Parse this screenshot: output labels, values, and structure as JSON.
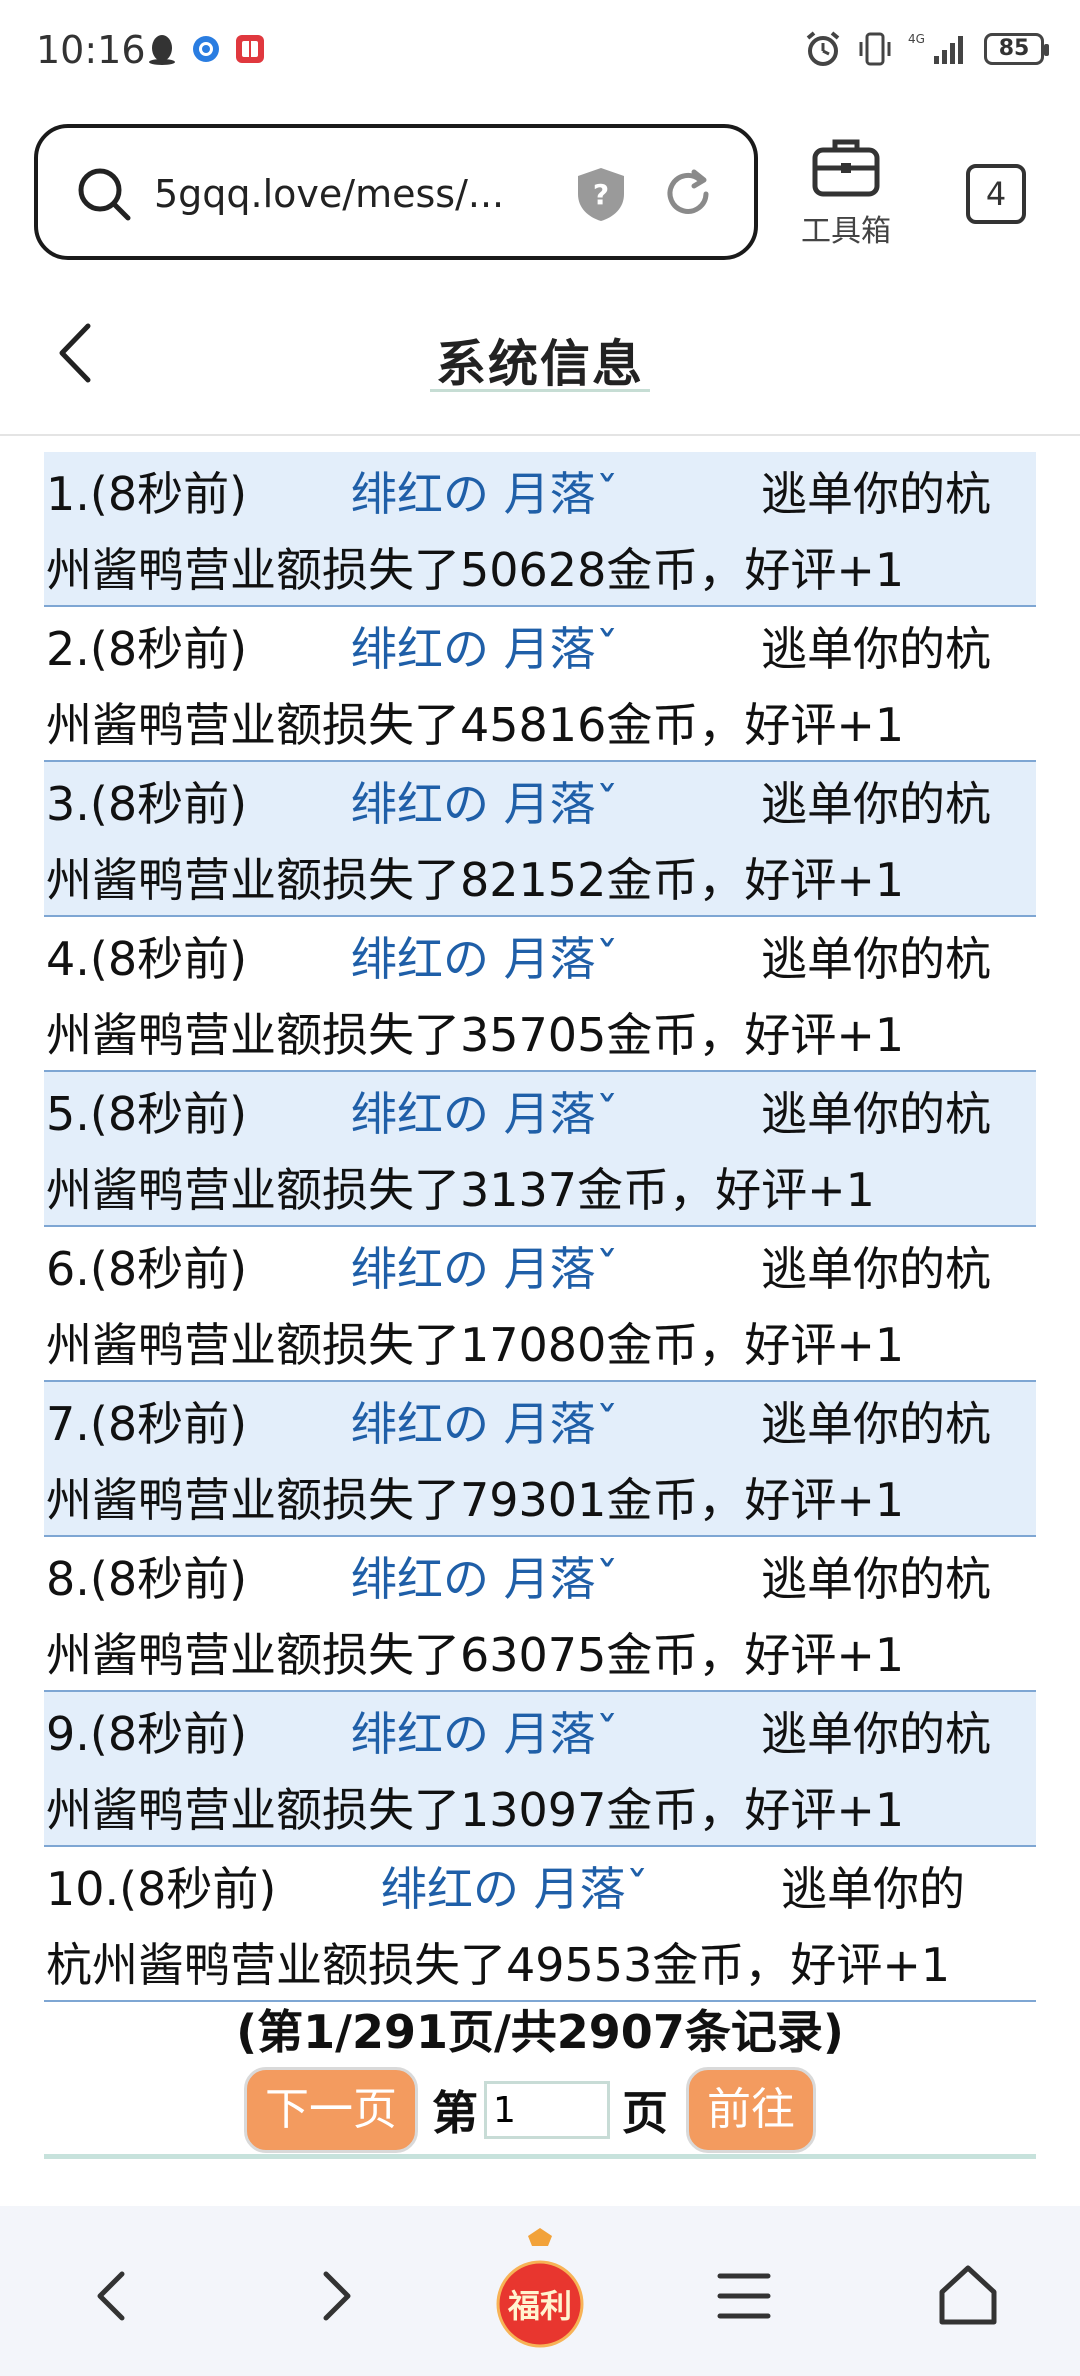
{
  "status_bar": {
    "time": "10:16",
    "network": "4G",
    "battery": "85"
  },
  "browser": {
    "url": "5gqq.love/mess/...",
    "toolbox_label": "工具箱",
    "tab_count": "4"
  },
  "page": {
    "title": "系统信息"
  },
  "messages": [
    {
      "index": "1.(8秒前)",
      "user": "绯红の  月落ˇ",
      "action": "逃单你的杭",
      "text": "州酱鸭营业额损失了50628金币，好评+1"
    },
    {
      "index": "2.(8秒前)",
      "user": "绯红の  月落ˇ",
      "action": "逃单你的杭",
      "text": "州酱鸭营业额损失了45816金币，好评+1"
    },
    {
      "index": "3.(8秒前)",
      "user": "绯红の  月落ˇ",
      "action": "逃单你的杭",
      "text": "州酱鸭营业额损失了82152金币，好评+1"
    },
    {
      "index": "4.(8秒前)",
      "user": "绯红の  月落ˇ",
      "action": "逃单你的杭",
      "text": "州酱鸭营业额损失了35705金币，好评+1"
    },
    {
      "index": "5.(8秒前)",
      "user": "绯红の  月落ˇ",
      "action": "逃单你的杭",
      "text": "州酱鸭营业额损失了3137金币，好评+1"
    },
    {
      "index": "6.(8秒前)",
      "user": "绯红の  月落ˇ",
      "action": "逃单你的杭",
      "text": "州酱鸭营业额损失了17080金币，好评+1"
    },
    {
      "index": "7.(8秒前)",
      "user": "绯红の  月落ˇ",
      "action": "逃单你的杭",
      "text": "州酱鸭营业额损失了79301金币，好评+1"
    },
    {
      "index": "8.(8秒前)",
      "user": "绯红の  月落ˇ",
      "action": "逃单你的杭",
      "text": "州酱鸭营业额损失了63075金币，好评+1"
    },
    {
      "index": "9.(8秒前)",
      "user": "绯红の  月落ˇ",
      "action": "逃单你的杭",
      "text": "州酱鸭营业额损失了13097金币，好评+1"
    },
    {
      "index": "10.(8秒前)",
      "user": "绯红の  月落ˇ",
      "action": "逃单你的",
      "text": "杭州酱鸭营业额损失了49553金币，好评+1"
    }
  ],
  "pagination": {
    "info": "(第1/291页/共2907条记录)",
    "next_label": "下一页",
    "page_prefix": "第",
    "page_value": "1",
    "page_suffix": "页",
    "go_label": "前往"
  },
  "bottom_nav": {
    "fuli_label": "福利"
  },
  "colors": {
    "link_blue": "#1f5fa8",
    "row_shade": "#e3eefa",
    "button_orange": "#f39b5f"
  }
}
